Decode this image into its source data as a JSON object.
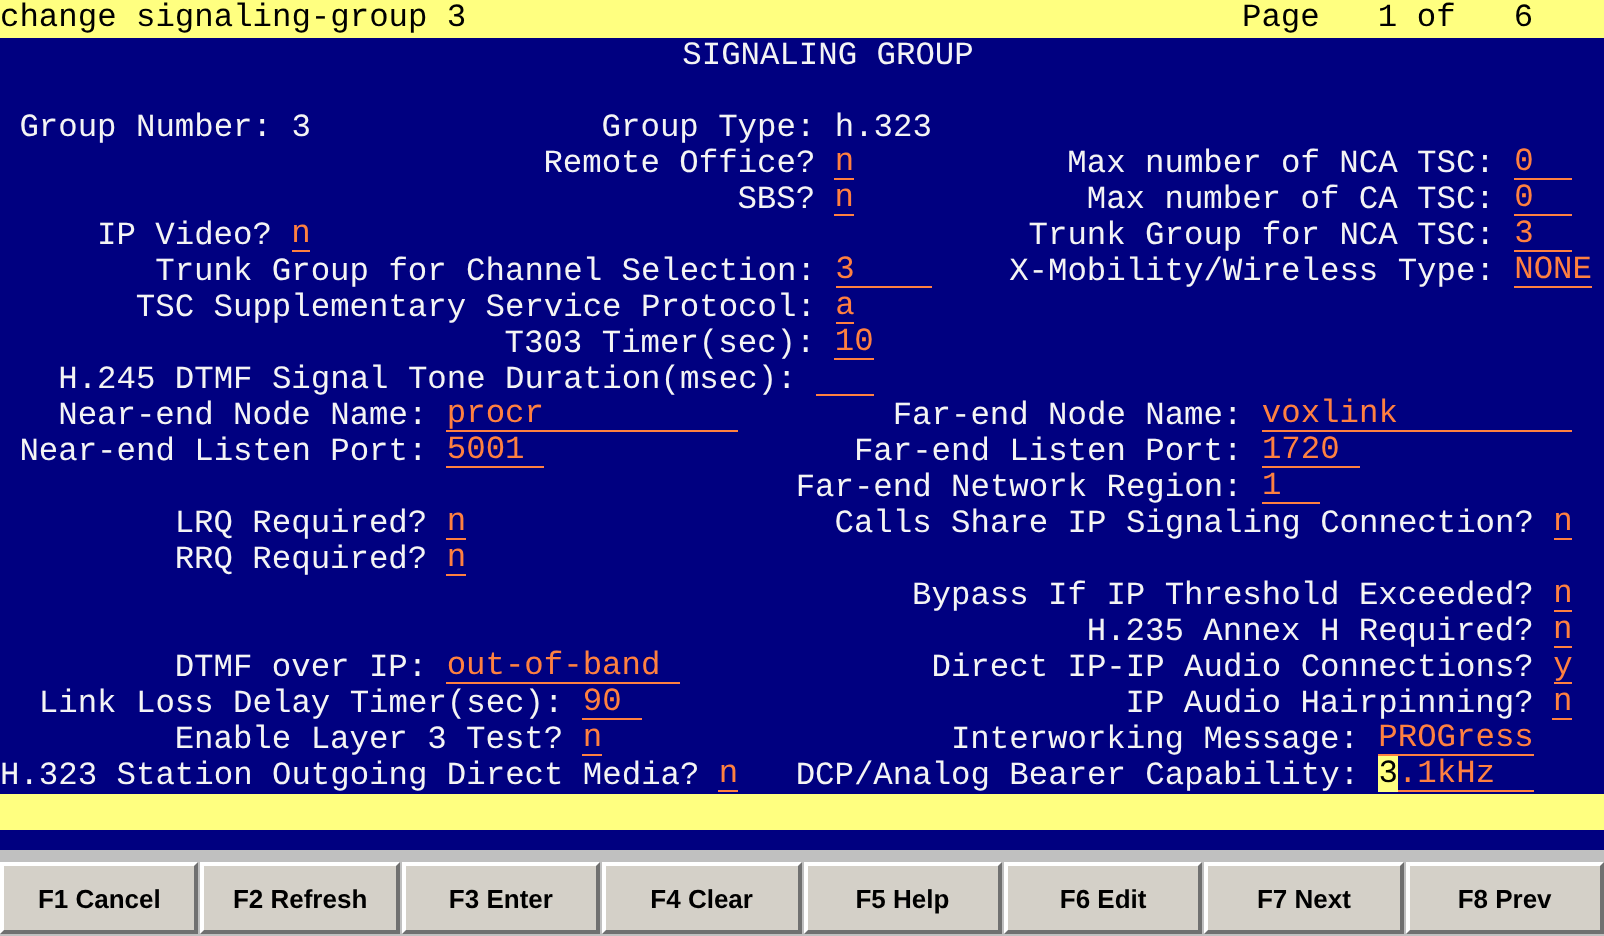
{
  "title_bar": {
    "command": "change signaling-group 3",
    "page_label": "Page",
    "page": "1 of",
    "total": "6"
  },
  "heading": "SIGNALING GROUP",
  "rows": [
    {
      "items": [
        {
          "label": "Group Number:",
          "value": "3",
          "kind": "display"
        },
        {
          "label": "Group Type:",
          "value": "h.323",
          "kind": "display"
        }
      ]
    },
    {
      "items": [
        {
          "label": "Remote Office?",
          "value": "n",
          "kind": "input"
        },
        {
          "label": "Max number of NCA TSC:",
          "value": "0",
          "kind": "input"
        }
      ]
    },
    {
      "items": [
        {
          "label": "SBS?",
          "value": "n",
          "kind": "input"
        },
        {
          "label": "Max number of CA TSC:",
          "value": "0",
          "kind": "input"
        }
      ]
    },
    {
      "items": [
        {
          "label": "IP Video?",
          "value": "n",
          "kind": "input"
        },
        {
          "label": "Trunk Group for NCA TSC:",
          "value": "3",
          "kind": "input"
        }
      ]
    },
    {
      "items": [
        {
          "label": "Trunk Group for Channel Selection:",
          "value": "3",
          "kind": "input"
        },
        {
          "label": "X-Mobility/Wireless Type:",
          "value": "NONE",
          "kind": "input"
        }
      ]
    },
    {
      "items": [
        {
          "label": "TSC Supplementary Service Protocol:",
          "value": "a",
          "kind": "input"
        }
      ]
    },
    {
      "items": [
        {
          "label": "T303 Timer(sec):",
          "value": "10",
          "kind": "input"
        }
      ]
    },
    {
      "items": [
        {
          "label": "H.245 DTMF Signal Tone Duration(msec):",
          "kind": "input"
        }
      ]
    },
    {
      "items": [
        {
          "label": "Near-end Node Name:",
          "value": "procr",
          "kind": "input"
        },
        {
          "label": "Far-end Node Name:",
          "value": "voxlink",
          "kind": "input"
        }
      ]
    },
    {
      "items": [
        {
          "label": "Near-end Listen Port:",
          "value": "5001",
          "kind": "input"
        },
        {
          "label": "Far-end Listen Port:",
          "value": "1720",
          "kind": "input"
        }
      ]
    },
    {
      "items": [
        {
          "label": "Far-end Network Region:",
          "value": "1",
          "kind": "input"
        }
      ]
    },
    {
      "items": [
        {
          "label": "LRQ Required?",
          "value": "n",
          "kind": "input"
        },
        {
          "label": "Calls Share IP Signaling Connection?",
          "value": "n",
          "kind": "input"
        }
      ]
    },
    {
      "items": [
        {
          "label": "RRQ Required?",
          "value": "n",
          "kind": "input"
        }
      ]
    },
    {
      "items": [
        {
          "label": "Bypass If IP Threshold Exceeded?",
          "value": "n",
          "kind": "input"
        }
      ]
    },
    {
      "items": [
        {
          "label": "H.235 Annex H Required?",
          "value": "n",
          "kind": "input"
        }
      ]
    },
    {
      "items": [
        {
          "label": "DTMF over IP:",
          "value": "out-of-band",
          "kind": "input"
        },
        {
          "label": "Direct IP-IP Audio Connections?",
          "value": "y",
          "kind": "input"
        }
      ]
    },
    {
      "items": [
        {
          "label": "Link Loss Delay Timer(sec):",
          "value": "90",
          "kind": "input"
        },
        {
          "label": "IP Audio Hairpinning?",
          "value": "n",
          "kind": "input"
        }
      ]
    },
    {
      "items": [
        {
          "label": "Enable Layer 3 Test?",
          "value": "n",
          "kind": "input"
        },
        {
          "label": "Interworking Message:",
          "value": "PROGress",
          "kind": "input"
        }
      ]
    },
    {
      "items": [
        {
          "label": "H.323 Station Outgoing Direct Media?",
          "value": "n",
          "kind": "input"
        },
        {
          "label": "DCP/Analog Bearer Capability:",
          "value": "3.1kHz",
          "kind": "input",
          "cursor": true
        }
      ]
    }
  ],
  "function_keys": [
    "F1 Cancel",
    "F2 Refresh",
    "F3 Enter",
    "F4 Clear",
    "F5 Help",
    "F6 Edit",
    "F7 Next",
    "F8 Prev"
  ]
}
